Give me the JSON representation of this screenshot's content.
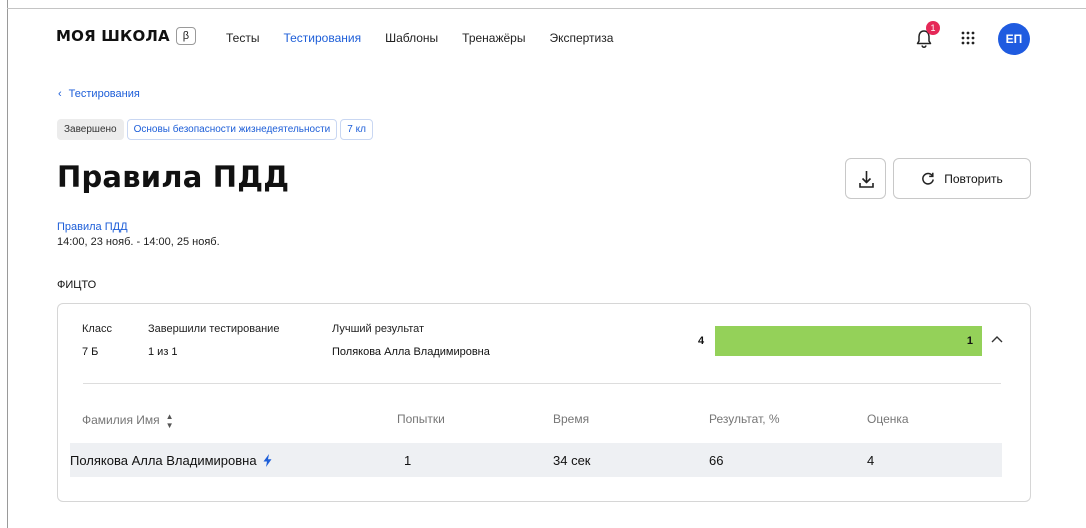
{
  "header": {
    "logo": "МОЯ ШКОЛА",
    "beta": "β",
    "nav": [
      "Тесты",
      "Тестирования",
      "Шаблоны",
      "Тренажёры",
      "Экспертиза"
    ],
    "active_nav": "Тестирования",
    "notification_count": "1",
    "avatar_initials": "ЕП"
  },
  "breadcrumb": {
    "back_label": "Тестирования"
  },
  "tags": {
    "status": "Завершено",
    "subject": "Основы безопасности жизнедеятельности",
    "grade": "7 кл"
  },
  "page": {
    "title": "Правила ПДД",
    "subject_link": "Правила ПДД",
    "dates": "14:00, 23 нояб. - 14:00, 25 нояб.",
    "group": "ФИЦТО"
  },
  "actions": {
    "repeat_label": "Повторить"
  },
  "summary": {
    "class_label": "Класс",
    "class_value": "7 Б",
    "completed_label": "Завершили тестирование",
    "completed_value": "1 из 1",
    "best_label": "Лучший результат",
    "best_value": "Полякова Алла Владимировна",
    "grade_distribution": {
      "grade": "4",
      "count": "1",
      "fill_fraction": 1.0
    }
  },
  "table": {
    "columns": [
      "Фамилия Имя",
      "Попытки",
      "Время",
      "Результат, %",
      "Оценка"
    ],
    "rows": [
      {
        "name": "Полякова Алла Владимировна",
        "attempts": "1",
        "time": "34 сек",
        "result": "66",
        "grade": "4"
      }
    ]
  },
  "colors": {
    "accent": "#1d5ed8",
    "avatar": "#1f5be0",
    "badge": "#e52857",
    "bar_fill": "#94d159",
    "row_bg": "#eef0f3"
  }
}
